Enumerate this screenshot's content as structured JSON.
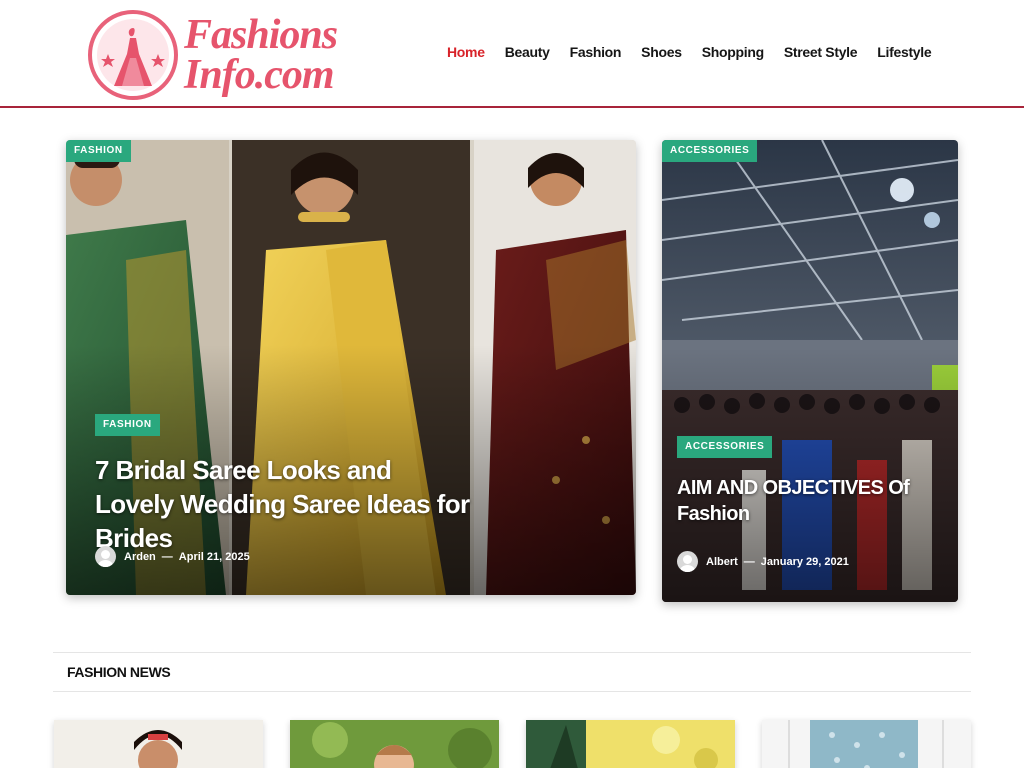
{
  "site": {
    "logo_line1": "Fashions",
    "logo_line2": "Info.com"
  },
  "nav": {
    "items": [
      {
        "label": "Home",
        "active": true
      },
      {
        "label": "Beauty"
      },
      {
        "label": "Fashion"
      },
      {
        "label": "Shoes"
      },
      {
        "label": "Shopping"
      },
      {
        "label": "Street Style"
      },
      {
        "label": "Lifestyle"
      }
    ]
  },
  "featured": {
    "main": {
      "top_category": "FASHION",
      "category": "FASHION",
      "title": "7 Bridal Saree Looks and Lovely Wedding Saree Ideas for Brides",
      "author": "Arden",
      "separator": "—",
      "date": "April 21, 2025"
    },
    "side": {
      "top_category": "ACCESSORIES",
      "category": "ACCESSORIES",
      "title": "AIM AND OBJECTIVES Of Fashion",
      "author": "Albert",
      "separator": "—",
      "date": "January 29, 2021"
    }
  },
  "section": {
    "title": "FASHION NEWS"
  },
  "colors": {
    "accent_red": "#d8232a",
    "badge_green": "#2aa87e",
    "header_border": "#a8243a",
    "logo_pink": "#e6546c"
  }
}
